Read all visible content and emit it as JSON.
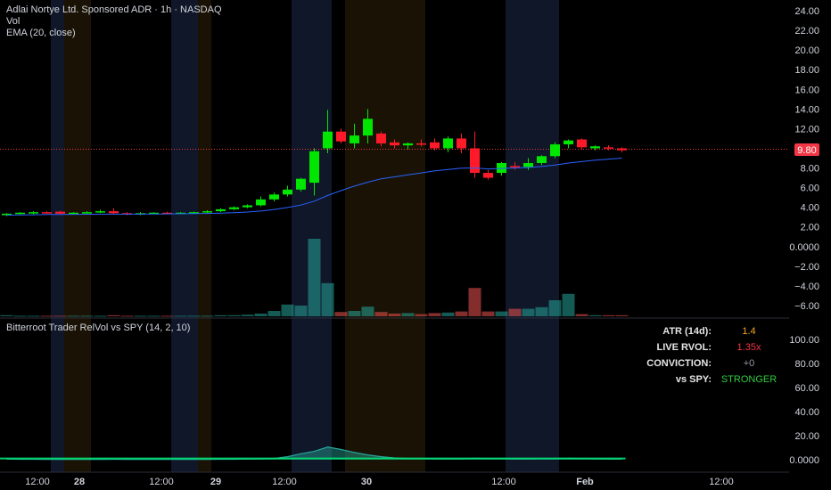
{
  "header": {
    "title": "Adlai Nortye Ltd. Sponsored ADR · 1h · NASDAQ",
    "vol_label": "Vol",
    "ema_label": "EMA (20, close)"
  },
  "indicator": {
    "title": "Bitterroot Trader RelVol vs SPY (14, 2, 10)"
  },
  "price_axis": {
    "ticks": [
      "24.00",
      "22.00",
      "20.00",
      "18.00",
      "16.00",
      "14.00",
      "12.00",
      "10.00",
      "8.00",
      "6.00",
      "4.00",
      "2.00",
      "0.0000",
      "−2.00",
      "−4.00",
      "−6.00"
    ],
    "last_price_label": "9.80"
  },
  "indicator_axis": {
    "ticks": [
      "100.00",
      "80.00",
      "60.00",
      "40.00",
      "20.00",
      "0.0000"
    ]
  },
  "time_axis": {
    "labels": [
      "12:00",
      "28",
      "12:00",
      "29",
      "12:00",
      "30",
      "12:00",
      "Feb",
      "12:00"
    ]
  },
  "stats_table": {
    "rows": [
      {
        "label": "ATR (14d):",
        "value": "1.4",
        "color": "#f5a623"
      },
      {
        "label": "LIVE RVOL:",
        "value": "1.35x",
        "color": "#f23645"
      },
      {
        "label": "CONVICTION:",
        "value": "+0",
        "color": "#9598a1"
      },
      {
        "label": "vs SPY:",
        "value": "STRONGER",
        "color": "#2ecc40"
      }
    ]
  },
  "colors": {
    "up": "#00e600",
    "down": "#ff1a2a",
    "vol_up": "#26a69a",
    "vol_down": "#ef5350",
    "ema": "#2962ff",
    "premarket_band": "#1c2a4a",
    "afterhours_band": "#3a2a0a",
    "last_price_tag": "#f23645"
  },
  "chart_data": {
    "type": "candlestick",
    "price_range": [
      -7,
      25
    ],
    "indicator_range": [
      -3,
      112
    ],
    "session_bands": [
      {
        "kind": "premarket",
        "start": 4.0,
        "end": 5.0
      },
      {
        "kind": "afterhours",
        "start": 5.0,
        "end": 7.0
      },
      {
        "kind": "premarket",
        "start": 13.0,
        "end": 15.0
      },
      {
        "kind": "afterhours",
        "start": 15.0,
        "end": 16.0
      },
      {
        "kind": "premarket",
        "start": 22.0,
        "end": 25.0
      },
      {
        "kind": "afterhours",
        "start": 26.0,
        "end": 32.0
      },
      {
        "kind": "premarket",
        "start": 38.0,
        "end": 42.0
      }
    ],
    "candles": [
      {
        "o": 3.2,
        "h": 3.4,
        "l": 3.1,
        "c": 3.35,
        "v": 0.2
      },
      {
        "o": 3.35,
        "h": 3.5,
        "l": 3.3,
        "c": 3.45,
        "v": 0.1
      },
      {
        "o": 3.45,
        "h": 3.6,
        "l": 3.3,
        "c": 3.5,
        "v": 0.1
      },
      {
        "o": 3.5,
        "h": 3.6,
        "l": 3.4,
        "c": 3.45,
        "v": 0.1
      },
      {
        "o": 3.55,
        "h": 3.65,
        "l": 3.3,
        "c": 3.35,
        "v": 0.1
      },
      {
        "o": 3.35,
        "h": 3.5,
        "l": 3.3,
        "c": 3.45,
        "v": 0.1
      },
      {
        "o": 3.45,
        "h": 3.6,
        "l": 3.4,
        "c": 3.5,
        "v": 0.1
      },
      {
        "o": 3.5,
        "h": 3.75,
        "l": 3.4,
        "c": 3.6,
        "v": 0.1
      },
      {
        "o": 3.6,
        "h": 3.9,
        "l": 3.3,
        "c": 3.4,
        "v": 0.2
      },
      {
        "o": 3.4,
        "h": 3.5,
        "l": 3.2,
        "c": 3.3,
        "v": 0.1
      },
      {
        "o": 3.3,
        "h": 3.5,
        "l": 3.2,
        "c": 3.4,
        "v": 0.1
      },
      {
        "o": 3.4,
        "h": 3.5,
        "l": 3.3,
        "c": 3.45,
        "v": 0.1
      },
      {
        "o": 3.45,
        "h": 3.55,
        "l": 3.3,
        "c": 3.4,
        "v": 0.1
      },
      {
        "o": 3.4,
        "h": 3.5,
        "l": 3.3,
        "c": 3.45,
        "v": 0.1
      },
      {
        "o": 3.45,
        "h": 3.55,
        "l": 3.35,
        "c": 3.5,
        "v": 0.1
      },
      {
        "o": 3.5,
        "h": 3.7,
        "l": 3.4,
        "c": 3.6,
        "v": 0.1
      },
      {
        "o": 3.6,
        "h": 3.9,
        "l": 3.5,
        "c": 3.8,
        "v": 0.2
      },
      {
        "o": 3.8,
        "h": 4.1,
        "l": 3.7,
        "c": 4.0,
        "v": 0.2
      },
      {
        "o": 4.0,
        "h": 4.3,
        "l": 3.9,
        "c": 4.2,
        "v": 0.3
      },
      {
        "o": 4.2,
        "h": 5.1,
        "l": 4.1,
        "c": 4.8,
        "v": 0.5
      },
      {
        "o": 4.8,
        "h": 5.5,
        "l": 4.6,
        "c": 5.3,
        "v": 1.0
      },
      {
        "o": 5.3,
        "h": 6.2,
        "l": 5.1,
        "c": 5.8,
        "v": 2.2
      },
      {
        "o": 5.8,
        "h": 7.0,
        "l": 5.6,
        "c": 6.9,
        "v": 2.0
      },
      {
        "o": 6.5,
        "h": 10.0,
        "l": 5.2,
        "c": 9.7,
        "v": 14.5
      },
      {
        "o": 10.0,
        "h": 13.9,
        "l": 9.5,
        "c": 11.7,
        "v": 6.2
      },
      {
        "o": 11.7,
        "h": 12.0,
        "l": 10.5,
        "c": 10.7,
        "v": 0.8
      },
      {
        "o": 10.5,
        "h": 12.5,
        "l": 10.0,
        "c": 11.3,
        "v": 1.0
      },
      {
        "o": 11.3,
        "h": 14.0,
        "l": 10.5,
        "c": 13.0,
        "v": 1.8
      },
      {
        "o": 11.5,
        "h": 11.7,
        "l": 10.2,
        "c": 10.5,
        "v": 0.8
      },
      {
        "o": 10.6,
        "h": 10.9,
        "l": 10.0,
        "c": 10.3,
        "v": 0.5
      },
      {
        "o": 10.3,
        "h": 10.6,
        "l": 9.9,
        "c": 10.5,
        "v": 0.6
      },
      {
        "o": 10.5,
        "h": 10.9,
        "l": 10.2,
        "c": 10.4,
        "v": 0.4
      },
      {
        "o": 10.6,
        "h": 11.0,
        "l": 9.8,
        "c": 10.0,
        "v": 0.6
      },
      {
        "o": 10.0,
        "h": 11.2,
        "l": 9.6,
        "c": 11.0,
        "v": 0.7
      },
      {
        "o": 11.0,
        "h": 11.5,
        "l": 9.5,
        "c": 10.0,
        "v": 0.9
      },
      {
        "o": 10.0,
        "h": 11.7,
        "l": 7.0,
        "c": 7.5,
        "v": 5.3
      },
      {
        "o": 7.5,
        "h": 7.8,
        "l": 6.8,
        "c": 7.0,
        "v": 0.9
      },
      {
        "o": 7.5,
        "h": 8.6,
        "l": 7.2,
        "c": 8.5,
        "v": 0.9
      },
      {
        "o": 8.2,
        "h": 8.6,
        "l": 7.8,
        "c": 8.1,
        "v": 1.4
      },
      {
        "o": 8.1,
        "h": 9.0,
        "l": 7.8,
        "c": 8.5,
        "v": 1.4
      },
      {
        "o": 8.5,
        "h": 9.3,
        "l": 8.3,
        "c": 9.2,
        "v": 1.7
      },
      {
        "o": 9.2,
        "h": 10.6,
        "l": 9.0,
        "c": 10.4,
        "v": 3.0
      },
      {
        "o": 10.4,
        "h": 10.9,
        "l": 10.0,
        "c": 10.8,
        "v": 4.2
      },
      {
        "o": 10.9,
        "h": 11.0,
        "l": 9.9,
        "c": 10.1,
        "v": 0.4
      },
      {
        "o": 10.0,
        "h": 10.3,
        "l": 9.8,
        "c": 10.2,
        "v": 0.2
      },
      {
        "o": 10.1,
        "h": 10.3,
        "l": 9.8,
        "c": 10.0,
        "v": 0.2
      },
      {
        "o": 10.0,
        "h": 10.1,
        "l": 9.6,
        "c": 9.8,
        "v": 0.2
      }
    ],
    "ema": [
      3.2,
      3.22,
      3.24,
      3.26,
      3.27,
      3.28,
      3.29,
      3.3,
      3.3,
      3.3,
      3.31,
      3.32,
      3.33,
      3.34,
      3.35,
      3.37,
      3.4,
      3.45,
      3.52,
      3.62,
      3.78,
      3.98,
      4.22,
      4.62,
      5.2,
      5.7,
      6.15,
      6.55,
      6.9,
      7.1,
      7.3,
      7.5,
      7.7,
      7.85,
      7.98,
      8.0,
      7.9,
      7.95,
      8.0,
      8.05,
      8.15,
      8.3,
      8.5,
      8.65,
      8.8,
      8.9,
      9.0
    ],
    "relvol": [
      0.5,
      0.4,
      0.4,
      0.3,
      0.3,
      0.3,
      0.3,
      0.3,
      0.4,
      0.3,
      0.3,
      0.3,
      0.3,
      0.3,
      0.3,
      0.3,
      0.4,
      0.4,
      0.5,
      0.6,
      1.0,
      2.5,
      5.0,
      7.0,
      10.5,
      8.5,
      6.0,
      4.0,
      2.5,
      1.5,
      1.0,
      0.8,
      0.7,
      0.6,
      0.6,
      1.2,
      0.9,
      0.8,
      0.7,
      0.7,
      0.8,
      1.0,
      1.2,
      0.9,
      0.6,
      0.5,
      0.5
    ],
    "relvol_baseline": [
      1.0
    ]
  }
}
